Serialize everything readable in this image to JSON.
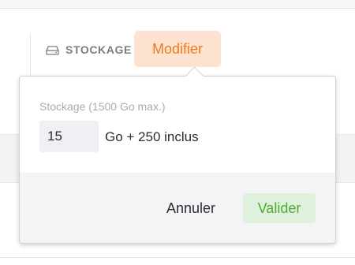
{
  "section": {
    "icon": "hard-drive-icon",
    "title": "STOCKAGE",
    "edit_label": "Modifier"
  },
  "popover": {
    "field_label": "Stockage (1500 Go max.)",
    "quantity_value": "15",
    "unit_text": "Go + 250 inclus",
    "cancel_label": "Annuler",
    "confirm_label": "Valider"
  },
  "colors": {
    "accent_orange": "#f07a1e",
    "accent_orange_bg": "#fde2cf",
    "confirm_green": "#4faa32",
    "confirm_green_bg": "#dff1da"
  }
}
